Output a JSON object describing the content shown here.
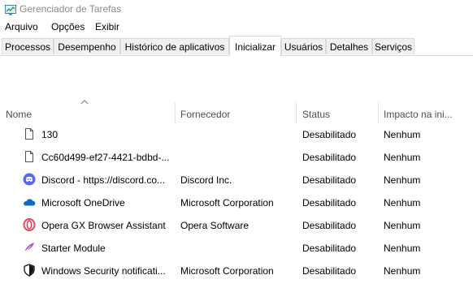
{
  "window": {
    "title": "Gerenciador de Tarefas"
  },
  "menu": [
    "Arquivo",
    "Opções",
    "Exibir"
  ],
  "tabs": [
    "Processos",
    "Desempenho",
    "Histórico de aplicativos",
    "Inicializar",
    "Usuários",
    "Detalhes",
    "Serviços"
  ],
  "active_tab": "Inicializar",
  "columns": {
    "name": "Nome",
    "vendor": "Fornecedor",
    "status": "Status",
    "impact": "Impacto na ini..."
  },
  "sort": {
    "column": "Nome",
    "direction": "ascending"
  },
  "rows": [
    {
      "icon": "blank-file-icon",
      "name": "130",
      "vendor": "",
      "status": "Desabilitado",
      "impact": "Nenhum"
    },
    {
      "icon": "blank-file-icon",
      "name": "Cc60d499-ef27-4421-bdbd-...",
      "vendor": "",
      "status": "Desabilitado",
      "impact": "Nenhum"
    },
    {
      "icon": "discord-icon",
      "name": "Discord - https://discord.co...",
      "vendor": "Discord Inc.",
      "status": "Desabilitado",
      "impact": "Nenhum"
    },
    {
      "icon": "onedrive-cloud-icon",
      "name": "Microsoft OneDrive",
      "vendor": "Microsoft Corporation",
      "status": "Desabilitado",
      "impact": "Nenhum"
    },
    {
      "icon": "opera-gx-icon",
      "name": "Opera GX Browser Assistant",
      "vendor": "Opera Software",
      "status": "Desabilitado",
      "impact": "Nenhum"
    },
    {
      "icon": "starter-feather-icon",
      "name": "Starter Module",
      "vendor": "",
      "status": "Desabilitado",
      "impact": "Nenhum"
    },
    {
      "icon": "shield-icon",
      "name": "Windows Security notificati...",
      "vendor": "Microsoft Corporation",
      "status": "Desabilitado",
      "impact": "Nenhum"
    }
  ],
  "colors": {
    "title_text": "#8a8a8a",
    "discord": "#5865f2",
    "onedrive": "#0f6cbd",
    "opera": "#e5435b",
    "starter": "#a24dd8"
  }
}
